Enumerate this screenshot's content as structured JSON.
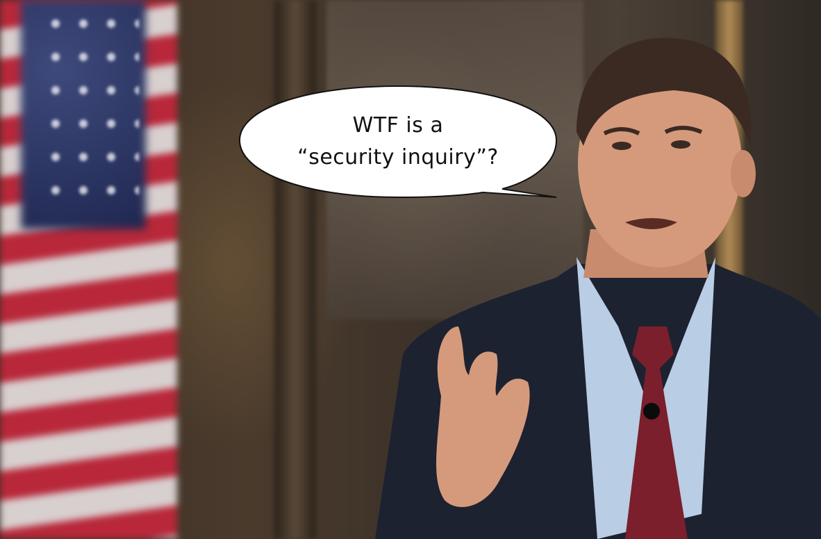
{
  "speech_bubble": {
    "line1": "WTF is a",
    "line2": "“security inquiry”?"
  },
  "colors": {
    "bubble_fill": "#ffffff",
    "bubble_stroke": "#111111",
    "suit": "#1c2230",
    "shirt": "#b9cde4",
    "tie": "#7a1f2b",
    "skin": "#d59a7c",
    "hair": "#3b2a22"
  }
}
